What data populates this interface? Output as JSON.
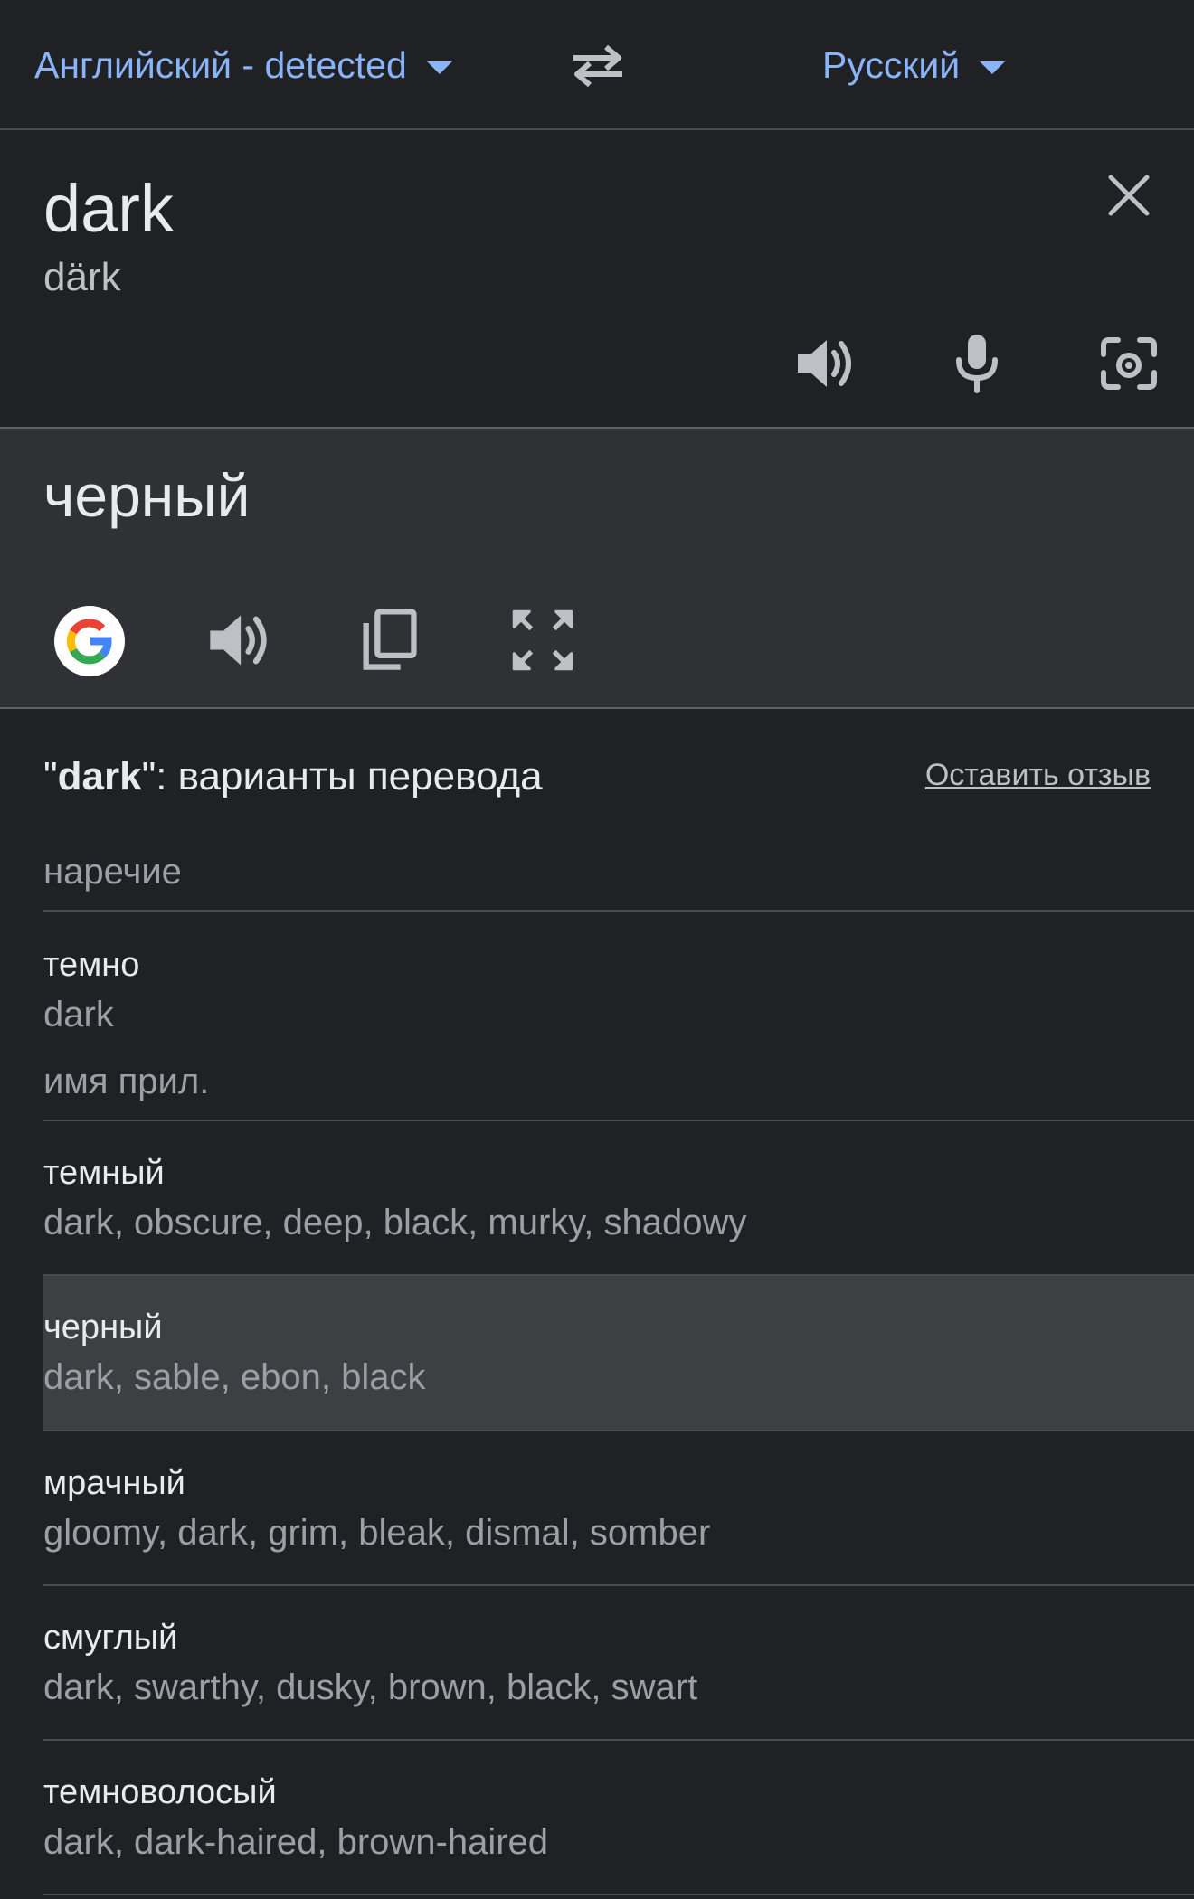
{
  "language_bar": {
    "source_language": "Английский - detected",
    "target_language": "Русский",
    "swap_icon": "swap-arrows-icon"
  },
  "source": {
    "text": "dark",
    "transliteration": "därk",
    "icons": [
      "speaker-icon",
      "microphone-icon",
      "camera-icon",
      "close-icon"
    ]
  },
  "translation": {
    "text": "черный",
    "icons": [
      "google-icon",
      "speaker-icon",
      "copy-icon",
      "fullscreen-icon"
    ]
  },
  "dictionary": {
    "header_prefix": "\"",
    "header_word": "dark",
    "header_suffix": "\": варианты перевода",
    "feedback_link": "Оставить отзыв",
    "sections": [
      {
        "pos": "наречие",
        "entries": [
          {
            "word": "темно",
            "synonyms": "dark"
          }
        ]
      },
      {
        "pos": "имя прил.",
        "entries": [
          {
            "word": "темный",
            "synonyms": "dark, obscure, deep, black, murky, shadowy"
          },
          {
            "word": "черный",
            "synonyms": "dark, sable, ebon, black"
          },
          {
            "word": "мрачный",
            "synonyms": "gloomy, dark, grim, bleak, dismal, somber"
          },
          {
            "word": "смуглый",
            "synonyms": "dark, swarthy, dusky, brown, black, swart"
          },
          {
            "word": "темноволосый",
            "synonyms": "dark, dark-haired, brown-haired"
          }
        ]
      }
    ]
  },
  "colors": {
    "background": "#202124",
    "panel": "#303134",
    "accent": "#8ab4f8",
    "highlight_row": "#3c4043"
  }
}
